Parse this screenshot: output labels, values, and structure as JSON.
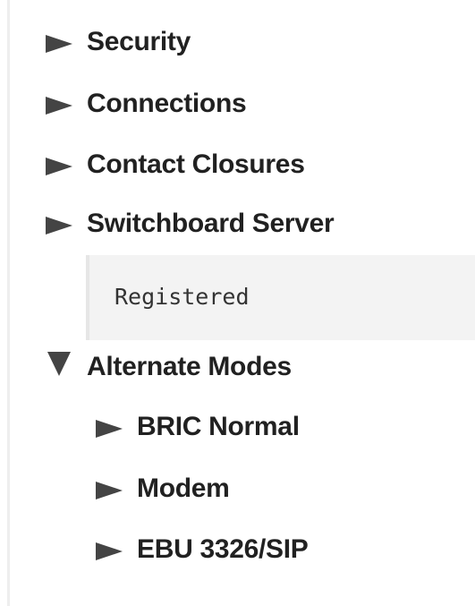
{
  "tree": {
    "items": [
      {
        "label": "Security",
        "expanded": false,
        "icon": "triangle-right-icon"
      },
      {
        "label": "Connections",
        "expanded": false,
        "icon": "triangle-right-icon"
      },
      {
        "label": "Contact Closures",
        "expanded": false,
        "icon": "triangle-right-icon"
      },
      {
        "label": "Switchboard Server",
        "expanded": false,
        "icon": "triangle-right-icon"
      },
      {
        "label": "Alternate Modes",
        "expanded": true,
        "icon": "triangle-down-icon"
      }
    ],
    "switchboard_status": "Registered",
    "alternate_modes": [
      {
        "label": "BRIC Normal",
        "expanded": false,
        "icon": "triangle-right-icon"
      },
      {
        "label": "Modem",
        "expanded": false,
        "icon": "triangle-right-icon"
      },
      {
        "label": "EBU 3326/SIP",
        "expanded": false,
        "icon": "triangle-right-icon"
      }
    ]
  },
  "colors": {
    "text": "#212121",
    "arrow": "#444444",
    "status_bg": "#f3f3f3"
  }
}
